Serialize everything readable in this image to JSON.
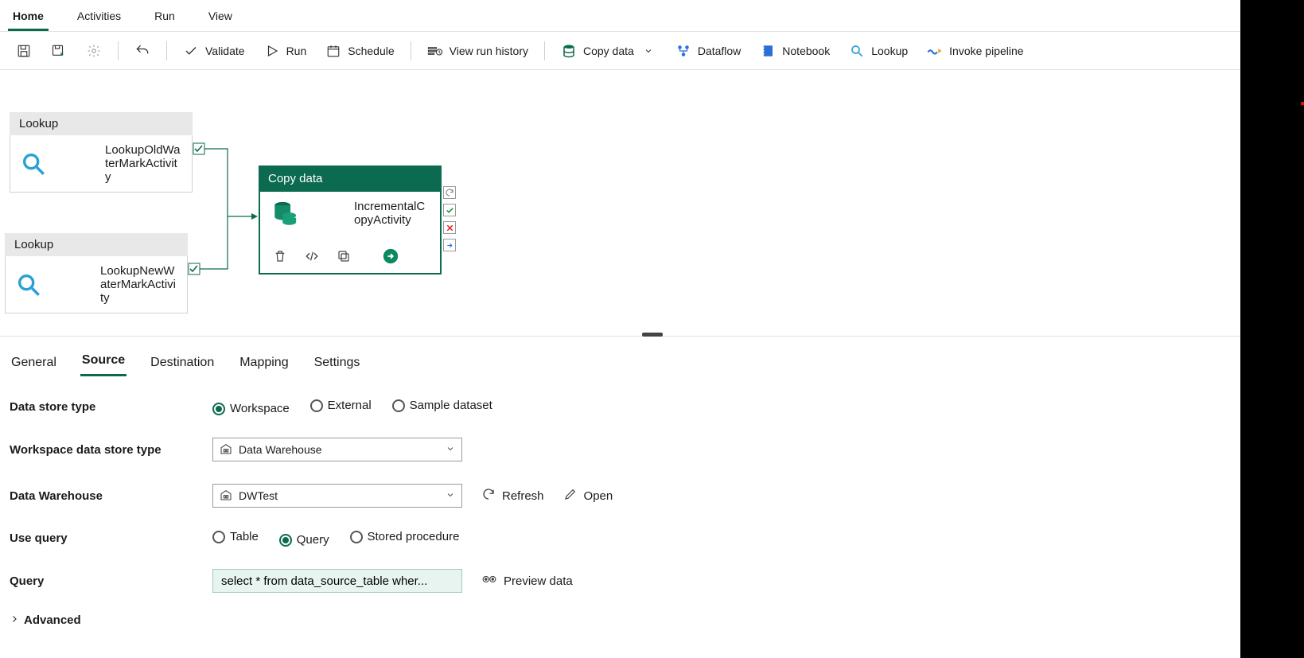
{
  "tabs": {
    "home": "Home",
    "activities": "Activities",
    "run": "Run",
    "view": "View"
  },
  "toolbar": {
    "validate": "Validate",
    "run": "Run",
    "schedule": "Schedule",
    "history": "View run history",
    "copy": "Copy data",
    "dataflow": "Dataflow",
    "notebook": "Notebook",
    "lookup": "Lookup",
    "invoke": "Invoke pipeline"
  },
  "nodes": {
    "lookup_type": "Lookup",
    "old_name": "LookupOldWaterMarkActivity",
    "new_name": "LookupNewWaterMarkActivity",
    "copy_type": "Copy data",
    "copy_name": "IncrementalCopyActivity"
  },
  "prop_tabs": {
    "general": "General",
    "source": "Source",
    "destination": "Destination",
    "mapping": "Mapping",
    "settings": "Settings"
  },
  "labels": {
    "dstype": "Data store type",
    "wstype": "Workspace data store type",
    "dw": "Data Warehouse",
    "useq": "Use query",
    "query": "Query",
    "adv": "Advanced"
  },
  "dstype_opts": {
    "ws": "Workspace",
    "ext": "External",
    "sample": "Sample dataset"
  },
  "wstype_value": "Data Warehouse",
  "dw_value": "DWTest",
  "refresh": "Refresh",
  "open": "Open",
  "useq_opts": {
    "table": "Table",
    "query": "Query",
    "sp": "Stored procedure"
  },
  "query_value": "select * from data_source_table wher...",
  "preview": "Preview data"
}
